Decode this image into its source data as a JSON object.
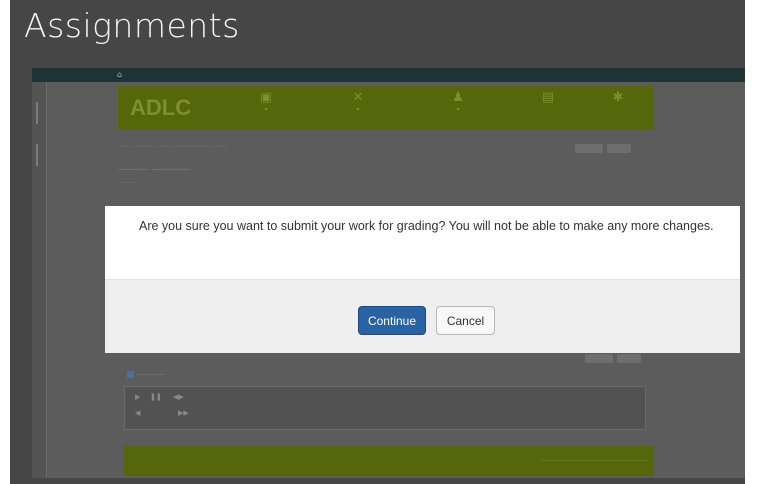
{
  "slide": {
    "title": "Assignments"
  },
  "modal": {
    "message": "Are you sure you want to submit your work for grading? You will not be able to make any more changes.",
    "continue_label": "Continue",
    "cancel_label": "Cancel"
  },
  "background_page": {
    "brand": "ADLC",
    "topbar_home_icon": "home-icon",
    "colors": {
      "banner": "#56660a",
      "continue_button": "#2a63a3",
      "overlay": "#464646"
    }
  }
}
